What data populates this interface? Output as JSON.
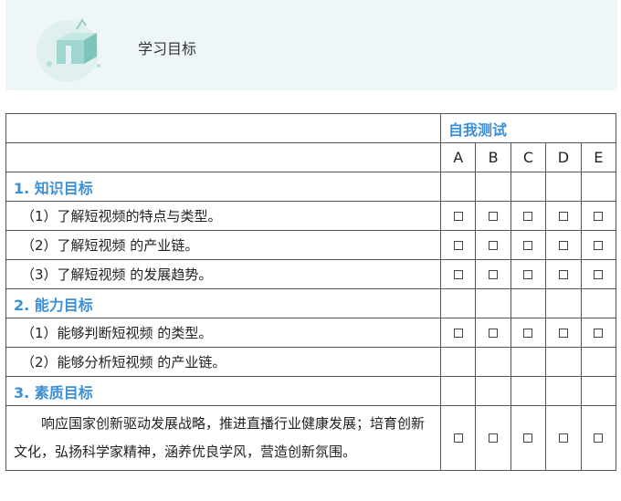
{
  "header": {
    "title": "学习目标",
    "icon": "gift-box-icon"
  },
  "table": {
    "group_header": "自我测试",
    "columns": [
      "A",
      "B",
      "C",
      "D",
      "E"
    ],
    "sections": [
      {
        "title": "1. 知识目标",
        "items": [
          {
            "text": "（1）了解短视频的特点与类型。",
            "checkboxes": true
          },
          {
            "text": "（2）了解短视频 的产业链。",
            "checkboxes": true
          },
          {
            "text": "（3）了解短视频 的发展趋势。",
            "checkboxes": true
          }
        ]
      },
      {
        "title": "2. 能力目标",
        "items": [
          {
            "text": "（1）能够判断短视频 的类型。",
            "checkboxes": true
          },
          {
            "text": "（2）能够分析短视频 的产业链。",
            "checkboxes": false
          }
        ]
      },
      {
        "title": "3. 素质目标",
        "items": [
          {
            "text": "响应国家创新驱动发展战略，推进直播行业健康发展；培育创新文化，弘扬科学家精神，涵养优良学风，营造创新氛围。",
            "checkboxes": true
          }
        ]
      }
    ]
  }
}
